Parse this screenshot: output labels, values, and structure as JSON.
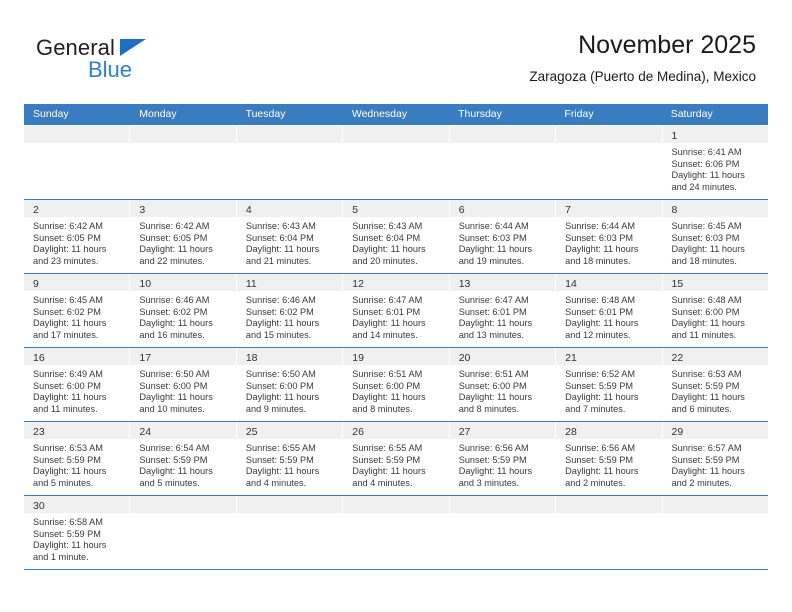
{
  "logo": {
    "word1": "General",
    "word2": "Blue",
    "triangle_color": "#1f6fc0",
    "blue_color": "#2f80c9"
  },
  "header": {
    "title": "November 2025",
    "subtitle": "Zaragoza (Puerto de Medina), Mexico"
  },
  "theme": {
    "header_blue": "#3a7cc0",
    "daynum_strip": "#f0f0f0",
    "text": "#3a3a3a"
  },
  "calendar": {
    "weekday_headers": [
      "Sunday",
      "Monday",
      "Tuesday",
      "Wednesday",
      "Thursday",
      "Friday",
      "Saturday"
    ],
    "weeks": [
      [
        {
          "day": "",
          "lines": []
        },
        {
          "day": "",
          "lines": []
        },
        {
          "day": "",
          "lines": []
        },
        {
          "day": "",
          "lines": []
        },
        {
          "day": "",
          "lines": []
        },
        {
          "day": "",
          "lines": []
        },
        {
          "day": "1",
          "lines": [
            "Sunrise: 6:41 AM",
            "Sunset: 6:06 PM",
            "Daylight: 11 hours",
            "and 24 minutes."
          ]
        }
      ],
      [
        {
          "day": "2",
          "lines": [
            "Sunrise: 6:42 AM",
            "Sunset: 6:05 PM",
            "Daylight: 11 hours",
            "and 23 minutes."
          ]
        },
        {
          "day": "3",
          "lines": [
            "Sunrise: 6:42 AM",
            "Sunset: 6:05 PM",
            "Daylight: 11 hours",
            "and 22 minutes."
          ]
        },
        {
          "day": "4",
          "lines": [
            "Sunrise: 6:43 AM",
            "Sunset: 6:04 PM",
            "Daylight: 11 hours",
            "and 21 minutes."
          ]
        },
        {
          "day": "5",
          "lines": [
            "Sunrise: 6:43 AM",
            "Sunset: 6:04 PM",
            "Daylight: 11 hours",
            "and 20 minutes."
          ]
        },
        {
          "day": "6",
          "lines": [
            "Sunrise: 6:44 AM",
            "Sunset: 6:03 PM",
            "Daylight: 11 hours",
            "and 19 minutes."
          ]
        },
        {
          "day": "7",
          "lines": [
            "Sunrise: 6:44 AM",
            "Sunset: 6:03 PM",
            "Daylight: 11 hours",
            "and 18 minutes."
          ]
        },
        {
          "day": "8",
          "lines": [
            "Sunrise: 6:45 AM",
            "Sunset: 6:03 PM",
            "Daylight: 11 hours",
            "and 18 minutes."
          ]
        }
      ],
      [
        {
          "day": "9",
          "lines": [
            "Sunrise: 6:45 AM",
            "Sunset: 6:02 PM",
            "Daylight: 11 hours",
            "and 17 minutes."
          ]
        },
        {
          "day": "10",
          "lines": [
            "Sunrise: 6:46 AM",
            "Sunset: 6:02 PM",
            "Daylight: 11 hours",
            "and 16 minutes."
          ]
        },
        {
          "day": "11",
          "lines": [
            "Sunrise: 6:46 AM",
            "Sunset: 6:02 PM",
            "Daylight: 11 hours",
            "and 15 minutes."
          ]
        },
        {
          "day": "12",
          "lines": [
            "Sunrise: 6:47 AM",
            "Sunset: 6:01 PM",
            "Daylight: 11 hours",
            "and 14 minutes."
          ]
        },
        {
          "day": "13",
          "lines": [
            "Sunrise: 6:47 AM",
            "Sunset: 6:01 PM",
            "Daylight: 11 hours",
            "and 13 minutes."
          ]
        },
        {
          "day": "14",
          "lines": [
            "Sunrise: 6:48 AM",
            "Sunset: 6:01 PM",
            "Daylight: 11 hours",
            "and 12 minutes."
          ]
        },
        {
          "day": "15",
          "lines": [
            "Sunrise: 6:48 AM",
            "Sunset: 6:00 PM",
            "Daylight: 11 hours",
            "and 11 minutes."
          ]
        }
      ],
      [
        {
          "day": "16",
          "lines": [
            "Sunrise: 6:49 AM",
            "Sunset: 6:00 PM",
            "Daylight: 11 hours",
            "and 11 minutes."
          ]
        },
        {
          "day": "17",
          "lines": [
            "Sunrise: 6:50 AM",
            "Sunset: 6:00 PM",
            "Daylight: 11 hours",
            "and 10 minutes."
          ]
        },
        {
          "day": "18",
          "lines": [
            "Sunrise: 6:50 AM",
            "Sunset: 6:00 PM",
            "Daylight: 11 hours",
            "and 9 minutes."
          ]
        },
        {
          "day": "19",
          "lines": [
            "Sunrise: 6:51 AM",
            "Sunset: 6:00 PM",
            "Daylight: 11 hours",
            "and 8 minutes."
          ]
        },
        {
          "day": "20",
          "lines": [
            "Sunrise: 6:51 AM",
            "Sunset: 6:00 PM",
            "Daylight: 11 hours",
            "and 8 minutes."
          ]
        },
        {
          "day": "21",
          "lines": [
            "Sunrise: 6:52 AM",
            "Sunset: 5:59 PM",
            "Daylight: 11 hours",
            "and 7 minutes."
          ]
        },
        {
          "day": "22",
          "lines": [
            "Sunrise: 6:53 AM",
            "Sunset: 5:59 PM",
            "Daylight: 11 hours",
            "and 6 minutes."
          ]
        }
      ],
      [
        {
          "day": "23",
          "lines": [
            "Sunrise: 6:53 AM",
            "Sunset: 5:59 PM",
            "Daylight: 11 hours",
            "and 5 minutes."
          ]
        },
        {
          "day": "24",
          "lines": [
            "Sunrise: 6:54 AM",
            "Sunset: 5:59 PM",
            "Daylight: 11 hours",
            "and 5 minutes."
          ]
        },
        {
          "day": "25",
          "lines": [
            "Sunrise: 6:55 AM",
            "Sunset: 5:59 PM",
            "Daylight: 11 hours",
            "and 4 minutes."
          ]
        },
        {
          "day": "26",
          "lines": [
            "Sunrise: 6:55 AM",
            "Sunset: 5:59 PM",
            "Daylight: 11 hours",
            "and 4 minutes."
          ]
        },
        {
          "day": "27",
          "lines": [
            "Sunrise: 6:56 AM",
            "Sunset: 5:59 PM",
            "Daylight: 11 hours",
            "and 3 minutes."
          ]
        },
        {
          "day": "28",
          "lines": [
            "Sunrise: 6:56 AM",
            "Sunset: 5:59 PM",
            "Daylight: 11 hours",
            "and 2 minutes."
          ]
        },
        {
          "day": "29",
          "lines": [
            "Sunrise: 6:57 AM",
            "Sunset: 5:59 PM",
            "Daylight: 11 hours",
            "and 2 minutes."
          ]
        }
      ],
      [
        {
          "day": "30",
          "lines": [
            "Sunrise: 6:58 AM",
            "Sunset: 5:59 PM",
            "Daylight: 11 hours",
            "and 1 minute."
          ]
        },
        {
          "day": "",
          "lines": []
        },
        {
          "day": "",
          "lines": []
        },
        {
          "day": "",
          "lines": []
        },
        {
          "day": "",
          "lines": []
        },
        {
          "day": "",
          "lines": []
        },
        {
          "day": "",
          "lines": []
        }
      ]
    ]
  }
}
